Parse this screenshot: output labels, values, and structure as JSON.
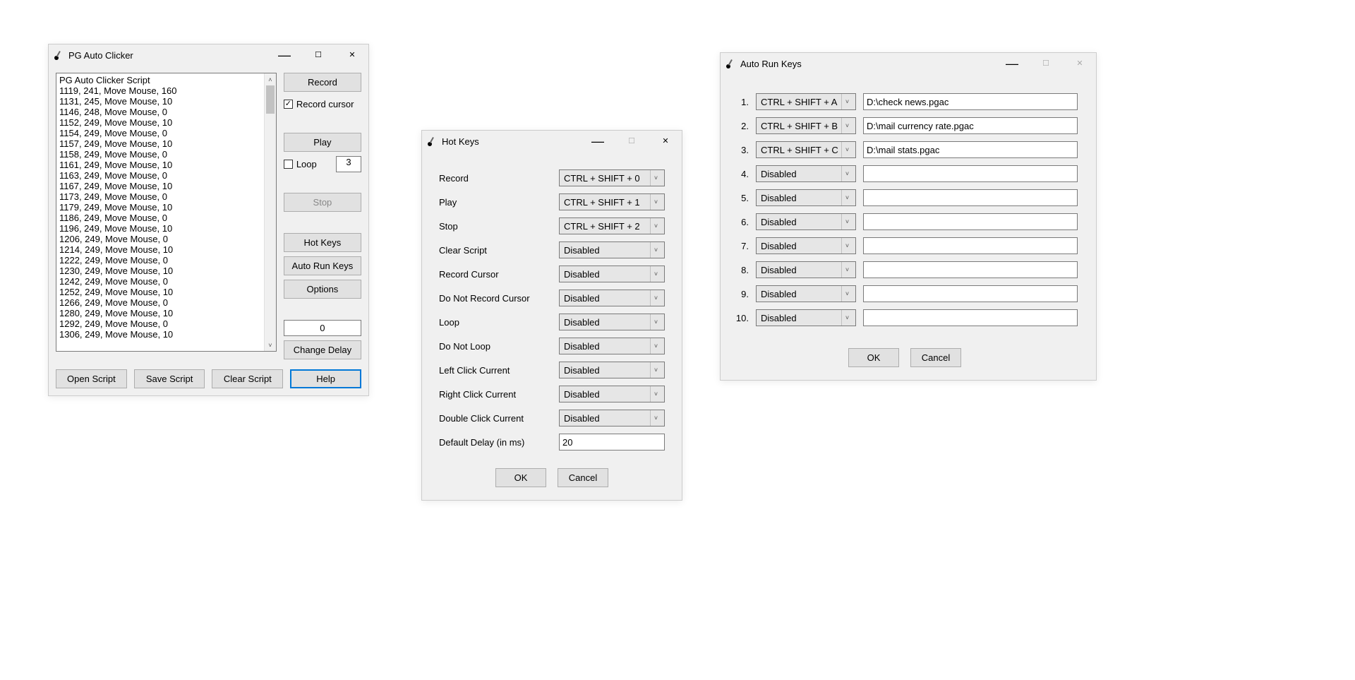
{
  "main": {
    "title": "PG Auto Clicker",
    "script_lines": [
      "PG Auto Clicker Script",
      "1119, 241, Move Mouse, 160",
      "1131, 245, Move Mouse, 10",
      "1146, 248, Move Mouse, 0",
      "1152, 249, Move Mouse, 10",
      "1154, 249, Move Mouse, 0",
      "1157, 249, Move Mouse, 10",
      "1158, 249, Move Mouse, 0",
      "1161, 249, Move Mouse, 10",
      "1163, 249, Move Mouse, 0",
      "1167, 249, Move Mouse, 10",
      "1173, 249, Move Mouse, 0",
      "1179, 249, Move Mouse, 10",
      "1186, 249, Move Mouse, 0",
      "1196, 249, Move Mouse, 10",
      "1206, 249, Move Mouse, 0",
      "1214, 249, Move Mouse, 10",
      "1222, 249, Move Mouse, 0",
      "1230, 249, Move Mouse, 10",
      "1242, 249, Move Mouse, 0",
      "1252, 249, Move Mouse, 10",
      "1266, 249, Move Mouse, 0",
      "1280, 249, Move Mouse, 10",
      "1292, 249, Move Mouse, 0",
      "1306, 249, Move Mouse, 10"
    ],
    "buttons": {
      "record": "Record",
      "record_cursor": "Record cursor",
      "play": "Play",
      "loop": "Loop",
      "loop_value": "3",
      "stop": "Stop",
      "hotkeys": "Hot Keys",
      "autorun": "Auto Run Keys",
      "options": "Options",
      "delay_value": "0",
      "change_delay": "Change Delay",
      "open_script": "Open Script",
      "save_script": "Save Script",
      "clear_script": "Clear Script",
      "help": "Help"
    }
  },
  "hotkeys": {
    "title": "Hot Keys",
    "rows": [
      {
        "label": "Record",
        "value": "CTRL + SHIFT + 0"
      },
      {
        "label": "Play",
        "value": "CTRL + SHIFT + 1"
      },
      {
        "label": "Stop",
        "value": "CTRL + SHIFT + 2"
      },
      {
        "label": "Clear Script",
        "value": "Disabled"
      },
      {
        "label": "Record Cursor",
        "value": "Disabled"
      },
      {
        "label": "Do Not Record Cursor",
        "value": "Disabled"
      },
      {
        "label": "Loop",
        "value": "Disabled"
      },
      {
        "label": "Do Not Loop",
        "value": "Disabled"
      },
      {
        "label": "Left Click Current",
        "value": "Disabled"
      },
      {
        "label": "Right Click Current",
        "value": "Disabled"
      },
      {
        "label": "Double Click Current",
        "value": "Disabled"
      }
    ],
    "default_delay_label": "Default Delay (in ms)",
    "default_delay_value": "20",
    "ok": "OK",
    "cancel": "Cancel"
  },
  "autorun": {
    "title": "Auto Run Keys",
    "rows": [
      {
        "num": "1.",
        "key": "CTRL + SHIFT + A",
        "path": "D:\\check news.pgac"
      },
      {
        "num": "2.",
        "key": "CTRL + SHIFT + B",
        "path": "D:\\mail currency rate.pgac"
      },
      {
        "num": "3.",
        "key": "CTRL + SHIFT + C",
        "path": "D:\\mail stats.pgac"
      },
      {
        "num": "4.",
        "key": "Disabled",
        "path": ""
      },
      {
        "num": "5.",
        "key": "Disabled",
        "path": ""
      },
      {
        "num": "6.",
        "key": "Disabled",
        "path": ""
      },
      {
        "num": "7.",
        "key": "Disabled",
        "path": ""
      },
      {
        "num": "8.",
        "key": "Disabled",
        "path": ""
      },
      {
        "num": "9.",
        "key": "Disabled",
        "path": ""
      },
      {
        "num": "10.",
        "key": "Disabled",
        "path": ""
      }
    ],
    "ok": "OK",
    "cancel": "Cancel"
  }
}
